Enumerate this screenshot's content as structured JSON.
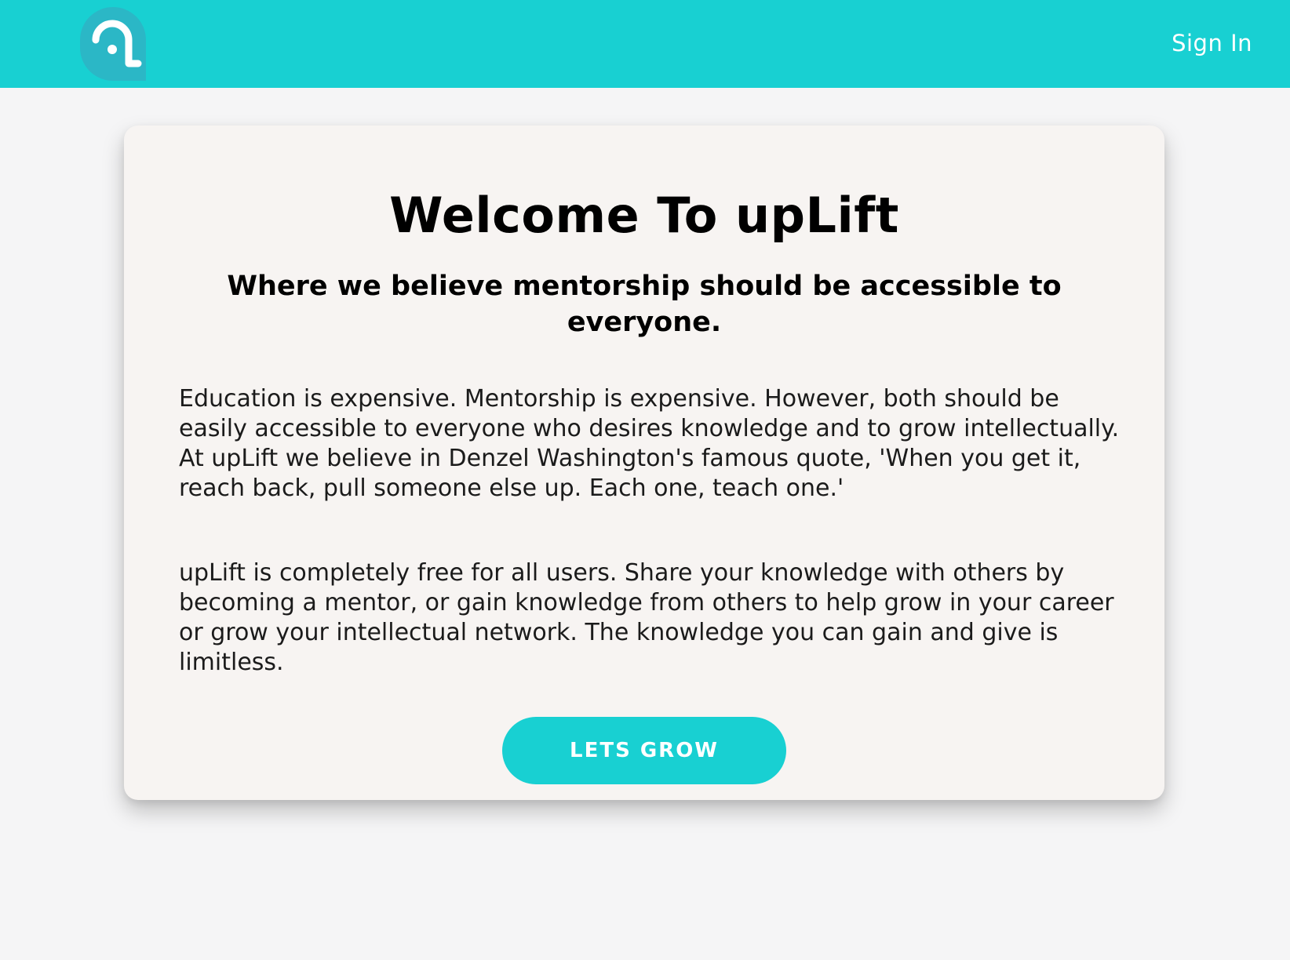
{
  "header": {
    "brand_color": "#18d0d2",
    "logo_icon": "uplift-logo-icon",
    "sign_in_label": "Sign In"
  },
  "card": {
    "title": "Welcome To upLift",
    "subtitle": "Where we believe mentorship should be accessible to everyone.",
    "paragraph_1": "Education is expensive. Mentorship is expensive. However, both should be easily accessible to everyone who desires knowledge and to grow intellectually. At upLift we believe in Denzel Washington's famous quote, 'When you get it, reach back, pull someone else up. Each one, teach one.'",
    "paragraph_2": "upLift is completely free for all users. Share your knowledge with others by becoming a mentor, or gain knowledge from others to help grow in your career or grow your intellectual network. The knowledge you can gain and give is limitless.",
    "cta_label": "LETS GROW"
  }
}
